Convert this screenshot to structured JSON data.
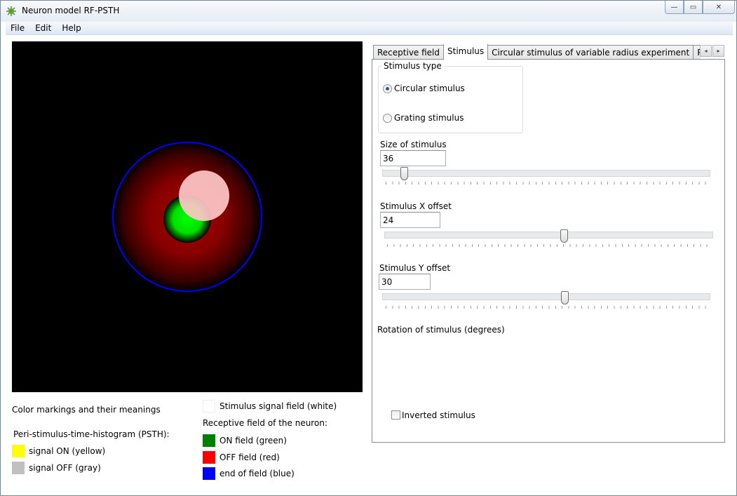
{
  "window": {
    "title": "Neuron model RF-PSTH",
    "icon": "neuron-app-icon",
    "controls": {
      "minimize": "—",
      "maximize": "▭",
      "close": "✕"
    }
  },
  "menu": [
    "File",
    "Edit",
    "Help"
  ],
  "canvas": {
    "background": "#000000",
    "on_field_color": "#00ff00",
    "off_field_color": "#8b0000",
    "boundary_color": "#0000ff",
    "stimulus_color": "#ffc8c8"
  },
  "legend": {
    "title": "Color markings and their meanings",
    "psth_title": "Peri-stimulus-time-histogram (PSTH):",
    "signal_on": {
      "label": "signal ON (yellow)",
      "color": "#ffff00"
    },
    "signal_off": {
      "label": "signal OFF (gray)",
      "color": "#c0c0c0"
    },
    "stimulus_field": {
      "label": "Stimulus signal field (white)",
      "color": "#ffffff"
    },
    "rf_title": "Receptive field of the neuron:",
    "on_field": {
      "label": "ON field (green)",
      "color": "#008000"
    },
    "off_field": {
      "label": "OFF field (red)",
      "color": "#ff0000"
    },
    "end_field": {
      "label": "end of field (blue)",
      "color": "#0000ff"
    }
  },
  "tabs": [
    "Receptive field",
    "Stimulus",
    "Circular stimulus of variable radius experiment",
    "Peri-stimul"
  ],
  "active_tab": "Stimulus",
  "tab_scroll": {
    "left": "◂",
    "right": "▸"
  },
  "stimulus": {
    "type_group_title": "Stimulus type",
    "types": [
      "Circular stimulus",
      "Grating stimulus"
    ],
    "selected_type": "Circular stimulus",
    "size_label": "Size of stimulus",
    "size_value": "36",
    "size_slider_fraction": 0.07,
    "x_label": "Stimulus X offset",
    "x_value": "24",
    "x_slider_fraction": 0.55,
    "y_label": "Stimulus Y offset",
    "y_value": "30",
    "y_slider_fraction": 0.56,
    "rotation_label": "Rotation of stimulus (degrees)",
    "inverted_label": "Inverted stimulus",
    "inverted_checked": false
  }
}
